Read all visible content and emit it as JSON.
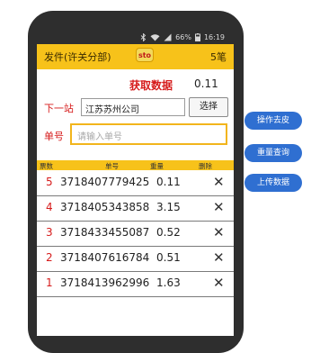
{
  "statusbar": {
    "battery_percent": "66%",
    "time": "16:19",
    "icons": [
      "bluetooth-icon",
      "wifi-icon",
      "signal-icon",
      "battery-icon"
    ]
  },
  "header": {
    "title": "发件(许关分部)",
    "logo_text": "sto",
    "count": "5笔"
  },
  "fetch": {
    "label": "获取数据",
    "value": "0.11"
  },
  "next_station": {
    "label": "下一站",
    "value": "江苏苏州公司",
    "select_label": "选择"
  },
  "danhao": {
    "label": "单号",
    "placeholder": "请输入单号"
  },
  "table": {
    "columns": [
      "票数",
      "单号",
      "重量",
      "删除"
    ],
    "rows": [
      {
        "idx": "5",
        "number": "3718407779425",
        "weight": "0.11",
        "delete": "✕"
      },
      {
        "idx": "4",
        "number": "3718405343858",
        "weight": "3.15",
        "delete": "✕"
      },
      {
        "idx": "3",
        "number": "3718433455087",
        "weight": "0.52",
        "delete": "✕"
      },
      {
        "idx": "2",
        "number": "3718407616784",
        "weight": "0.51",
        "delete": "✕"
      },
      {
        "idx": "1",
        "number": "3718413962996",
        "weight": "1.63",
        "delete": "✕"
      }
    ]
  },
  "side_buttons": [
    {
      "label": "操作去皮"
    },
    {
      "label": "重量查询"
    },
    {
      "label": "上传数据"
    }
  ],
  "colors": {
    "accent": "#f7c21a",
    "label_red": "#d61b1b",
    "side_button": "#2f6fd1",
    "phone_frame": "#2e2e2e"
  }
}
